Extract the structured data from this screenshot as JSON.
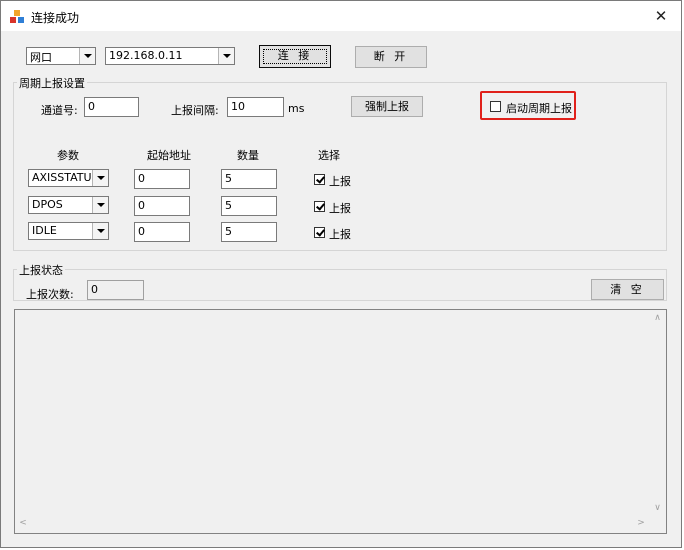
{
  "window": {
    "title": "连接成功"
  },
  "connection": {
    "type_value": "网口",
    "ip_value": "192.168.0.11",
    "connect_label": "连 接",
    "disconnect_label": "断 开"
  },
  "periodic": {
    "group_label": "周期上报设置",
    "channel_label": "通道号:",
    "channel_value": "0",
    "interval_label": "上报间隔:",
    "interval_value": "10",
    "interval_unit": "ms",
    "force_label": "强制上报",
    "enable_label": "启动周期上报",
    "headers": {
      "param": "参数",
      "addr": "起始地址",
      "count": "数量",
      "select": "选择"
    },
    "rows": [
      {
        "param": "AXISSTATUS",
        "addr": "0",
        "count": "5",
        "select": "上报"
      },
      {
        "param": "DPOS",
        "addr": "0",
        "count": "5",
        "select": "上报"
      },
      {
        "param": "IDLE",
        "addr": "0",
        "count": "5",
        "select": "上报"
      }
    ]
  },
  "status": {
    "group_label": "上报状态",
    "count_label": "上报次数:",
    "count_value": "0",
    "clear_label": "清 空"
  },
  "colors": {
    "highlight": "#e0201a",
    "face": "#f0f0f0"
  }
}
